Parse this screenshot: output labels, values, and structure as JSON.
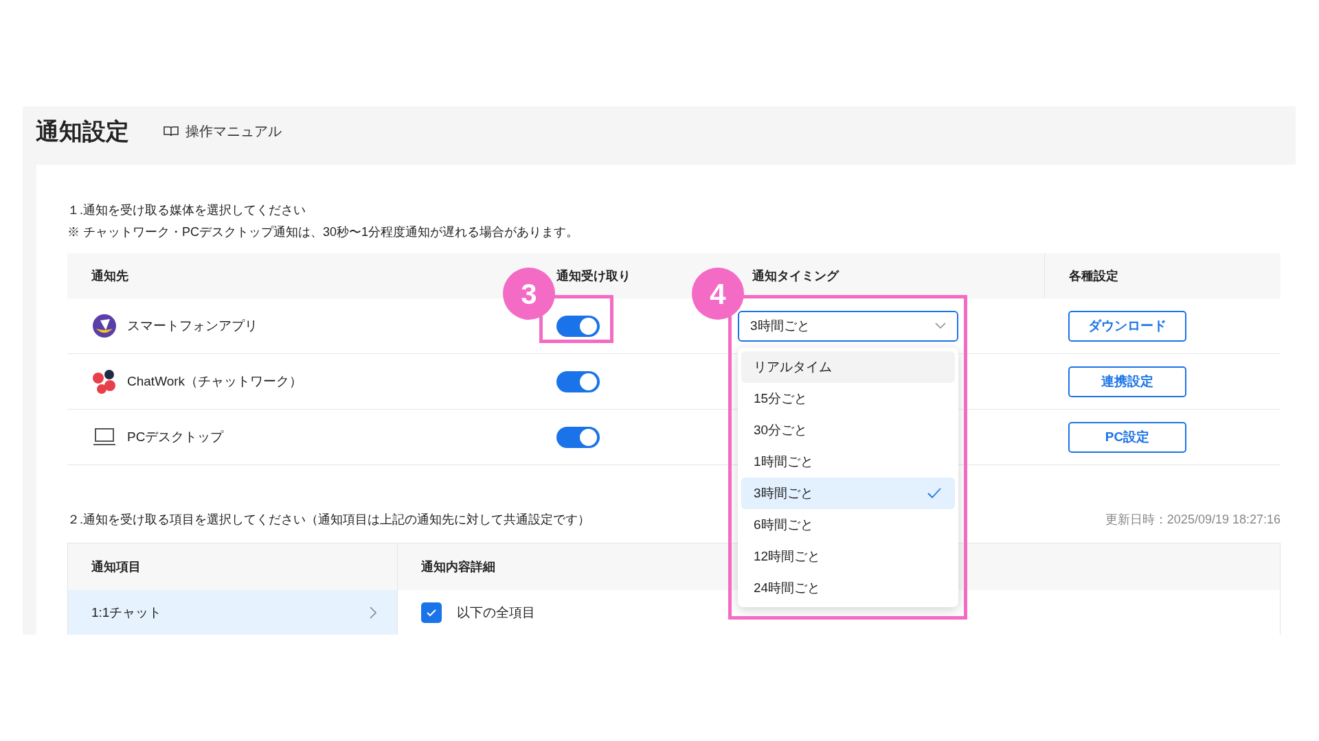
{
  "page": {
    "title": "通知設定",
    "manual_link": "操作マニュアル"
  },
  "section1": {
    "heading": "１.通知を受け取る媒体を選択してください",
    "note": "※ チャットワーク・PCデスクトップ通知は、30秒〜1分程度通知が遅れる場合があります。",
    "columns": [
      "通知先",
      "通知受け取り",
      "通知タイミング",
      "各種設定"
    ],
    "rows": [
      {
        "kind": "app",
        "name": "スマートフォンアプリ",
        "on": true,
        "timing": "3時間ごと",
        "button": "ダウンロード"
      },
      {
        "kind": "chatwork",
        "name": "ChatWork（チャットワーク）",
        "on": true,
        "button": "連携設定"
      },
      {
        "kind": "desktop",
        "name": "PCデスクトップ",
        "on": true,
        "button": "PC設定"
      }
    ]
  },
  "timing_dropdown": {
    "options": [
      {
        "label": "リアルタイム",
        "selected": false,
        "highlighted": true
      },
      {
        "label": "15分ごと",
        "selected": false,
        "highlighted": false
      },
      {
        "label": "30分ごと",
        "selected": false,
        "highlighted": false
      },
      {
        "label": "1時間ごと",
        "selected": false,
        "highlighted": false
      },
      {
        "label": "3時間ごと",
        "selected": true,
        "highlighted": false
      },
      {
        "label": "6時間ごと",
        "selected": false,
        "highlighted": false
      },
      {
        "label": "12時間ごと",
        "selected": false,
        "highlighted": false
      },
      {
        "label": "24時間ごと",
        "selected": false,
        "highlighted": false
      }
    ]
  },
  "section2": {
    "heading": "２.通知を受け取る項目を選択してください（通知項目は上記の通知先に対して共通設定です）",
    "updated": "更新日時：2025/09/19 18:27:16",
    "columns": [
      "通知項目",
      "通知内容詳細"
    ],
    "items": [
      {
        "label": "1:1チャット",
        "selected": true
      }
    ],
    "details": [
      {
        "label": "以下の全項目",
        "checked": true
      }
    ]
  },
  "annotations": [
    {
      "label": "3"
    },
    {
      "label": "4"
    }
  ]
}
